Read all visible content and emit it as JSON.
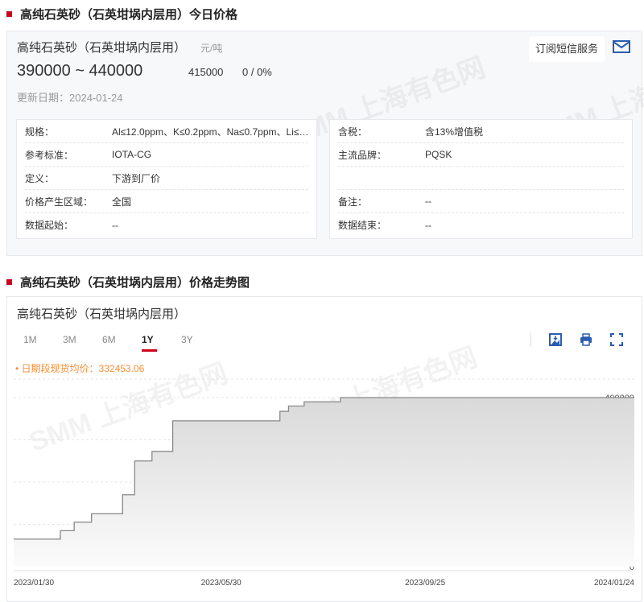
{
  "section1_title": "高纯石英砂（石英坩埚内层用）今日价格",
  "product": {
    "name": "高纯石英砂（石英坩埚内层用）",
    "unit": "元/吨",
    "range": "390000 ~ 440000",
    "average": "415000",
    "change": "0 / 0%",
    "updated": "更新日期：2024-01-24",
    "subscribe": "订阅短信服务"
  },
  "watermark": "SMM 上海有色网",
  "left_table": [
    {
      "k": "规格：",
      "v": "Al≤12.0ppm、K≤0.2ppm、Na≤0.7ppm、Li≤…"
    },
    {
      "k": "参考标准：",
      "v": "IOTA-CG"
    },
    {
      "k": "定义：",
      "v": "下游到厂价"
    },
    {
      "k": "价格产生区域：",
      "v": "全国"
    },
    {
      "k": "数据起始：",
      "v": "--"
    }
  ],
  "right_table": [
    {
      "k": "含税：",
      "v": "含13%增值税"
    },
    {
      "k": "主流品牌：",
      "v": "PQSK"
    },
    {
      "k": "",
      "v": ""
    },
    {
      "k": "备注：",
      "v": "--"
    },
    {
      "k": "数据结束：",
      "v": "--"
    }
  ],
  "section2_title": "高纯石英砂（石英坩埚内层用）价格走势图",
  "chart_title": "高纯石英砂（石英坩埚内层用）",
  "tabs": [
    "1M",
    "3M",
    "6M",
    "1Y",
    "3Y"
  ],
  "active_tab": "1Y",
  "legend": "日期段现货均价：332453.06",
  "colors": {
    "accent": "#d0021b",
    "legend": "#f5903a",
    "icon": "#2a5db0"
  },
  "chart_data": {
    "type": "area",
    "title": "高纯石英砂（石英坩埚内层用）",
    "x_range": [
      "2023-01-30",
      "2024-01-24"
    ],
    "x_ticks": [
      "2023/01/30",
      "2023/05/30",
      "2023/09/25",
      "2024/01/24"
    ],
    "y_ticks": [
      "0",
      "100000",
      "200000",
      "300000",
      "400000"
    ],
    "ylim": [
      0,
      440000
    ],
    "step_series": [
      {
        "date": "2023-01-30",
        "value": 65000
      },
      {
        "date": "2023-02-26",
        "value": 85000
      },
      {
        "date": "2023-03-06",
        "value": 105000
      },
      {
        "date": "2023-03-16",
        "value": 125000
      },
      {
        "date": "2023-04-03",
        "value": 170000
      },
      {
        "date": "2023-04-10",
        "value": 250000
      },
      {
        "date": "2023-04-20",
        "value": 272500
      },
      {
        "date": "2023-05-02",
        "value": 345000
      },
      {
        "date": "2023-07-03",
        "value": 367500
      },
      {
        "date": "2023-07-08",
        "value": 380000
      },
      {
        "date": "2023-07-17",
        "value": 390000
      },
      {
        "date": "2023-08-07",
        "value": 400000
      },
      {
        "date": "2024-01-24",
        "value": 400000
      }
    ]
  }
}
